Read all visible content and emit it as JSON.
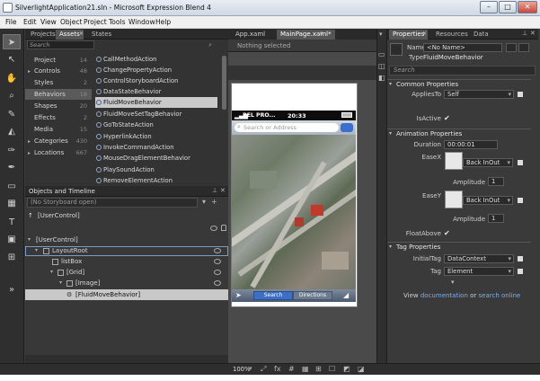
{
  "window": {
    "title": "SilverlightApplication21.sln - Microsoft Expression Blend 4"
  },
  "menu": [
    "File",
    "Edit",
    "View",
    "Object",
    "Project",
    "Tools",
    "Window",
    "Help"
  ],
  "left_tabs": [
    "Projects",
    "Assets",
    "States"
  ],
  "assets_search_placeholder": "Search",
  "categories": [
    {
      "name": "Project",
      "count": "14"
    },
    {
      "name": "Controls",
      "count": "48"
    },
    {
      "name": "Styles",
      "count": "2"
    },
    {
      "name": "Behaviors",
      "count": "18"
    },
    {
      "name": "Shapes",
      "count": "20"
    },
    {
      "name": "Effects",
      "count": "2"
    },
    {
      "name": "Media",
      "count": "15"
    },
    {
      "name": "Categories",
      "count": "430"
    },
    {
      "name": "Locations",
      "count": "667"
    }
  ],
  "assets": [
    "CallMethodAction",
    "ChangePropertyAction",
    "ControlStoryboardAction",
    "DataStateBehavior",
    "FluidMoveBehavior",
    "FluidMoveSetTagBehavior",
    "GoToStateAction",
    "HyperlinkAction",
    "InvokeCommandAction",
    "MouseDragElementBehavior",
    "PlaySoundAction",
    "RemoveElementAction"
  ],
  "selected_asset": "FluidMoveBehavior",
  "objects_panel": {
    "title": "Objects and Timeline",
    "storyboard": "(No Storyboard open)",
    "usercontrol_header": "[UserControl]",
    "tree": [
      "[UserControl]",
      "LayoutRoot",
      "listBox",
      "[Grid]",
      "[Image]",
      "[FluidMoveBehavior]"
    ]
  },
  "center": {
    "tabs": [
      "App.xaml",
      "MainPage.xaml*"
    ],
    "status": "Nothing selected",
    "zoom": "100%",
    "phone": {
      "carrier": "BEL PRO...",
      "time": "20:33",
      "address_placeholder": "Search or Address",
      "search_btn": "Search",
      "directions_btn": "Directions"
    }
  },
  "properties": {
    "tabs": [
      "Properties",
      "Resources",
      "Data"
    ],
    "name_label": "Name",
    "name_value": "<No Name>",
    "type_label": "Type",
    "type_value": "FluidMoveBehavior",
    "search_placeholder": "Search",
    "sections": {
      "common": "Common Properties",
      "animation": "Animation Properties",
      "tag": "Tag Properties"
    },
    "applies_to_label": "AppliesTo",
    "applies_to_value": "Self",
    "is_active_label": "IsActive",
    "duration_label": "Duration",
    "duration_value": "00:00:01",
    "easex_label": "EaseX",
    "easex_value": "Back InOut",
    "amplitude_label": "Amplitude",
    "amplitude_x": "1",
    "easey_label": "EaseY",
    "easey_value": "Back InOut",
    "amplitude_y": "1",
    "float_above_label": "FloatAbove",
    "initial_tag_label": "InitialTag",
    "initial_tag_value": "DataContext",
    "tag_label": "Tag",
    "tag_value": "Element",
    "footer_pre": "View",
    "footer_link1": "documentation",
    "footer_mid": "or",
    "footer_link2": "search online"
  }
}
